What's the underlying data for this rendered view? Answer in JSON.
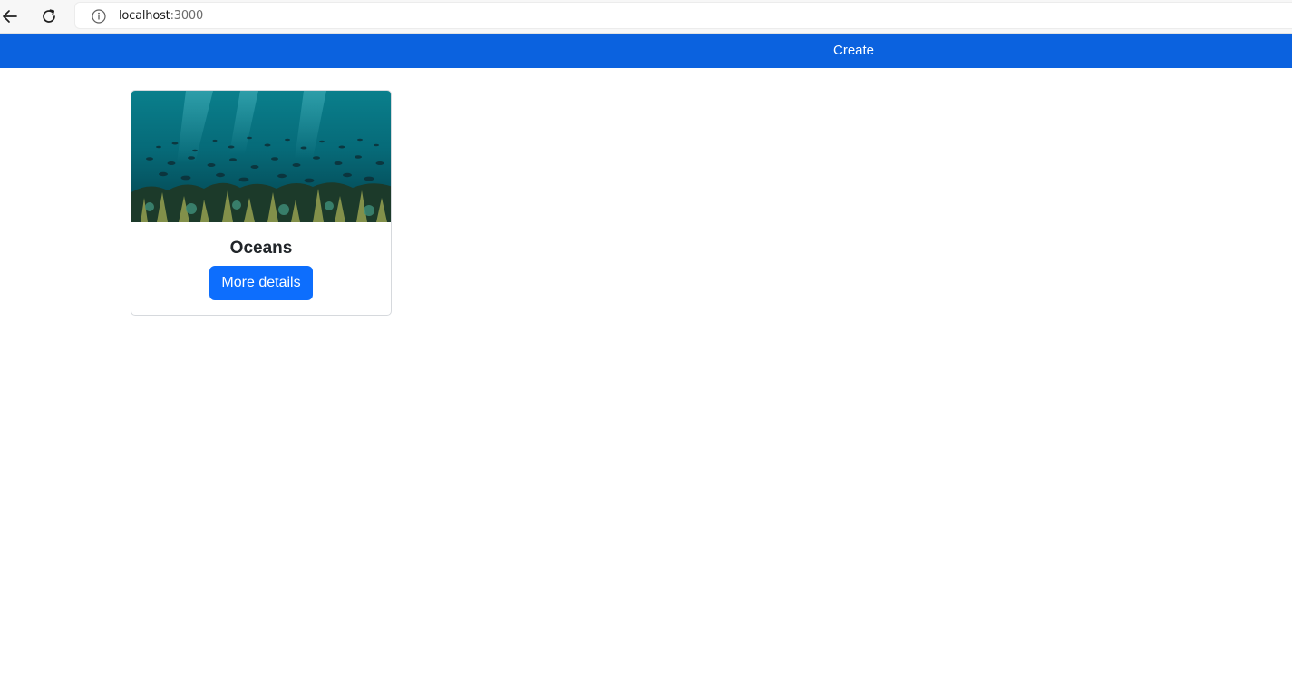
{
  "browser": {
    "url_host": "localhost",
    "url_port": ":3000",
    "icons": {
      "back": "arrow-left-icon",
      "reload": "reload-icon",
      "info": "info-circle-icon"
    }
  },
  "navbar": {
    "create_label": "Create",
    "background": "#0b62df"
  },
  "cards": [
    {
      "title": "Oceans",
      "image": "underwater-coral-reef-fish-photo",
      "button_label": "More details",
      "button_color": "#0d6efd"
    }
  ]
}
